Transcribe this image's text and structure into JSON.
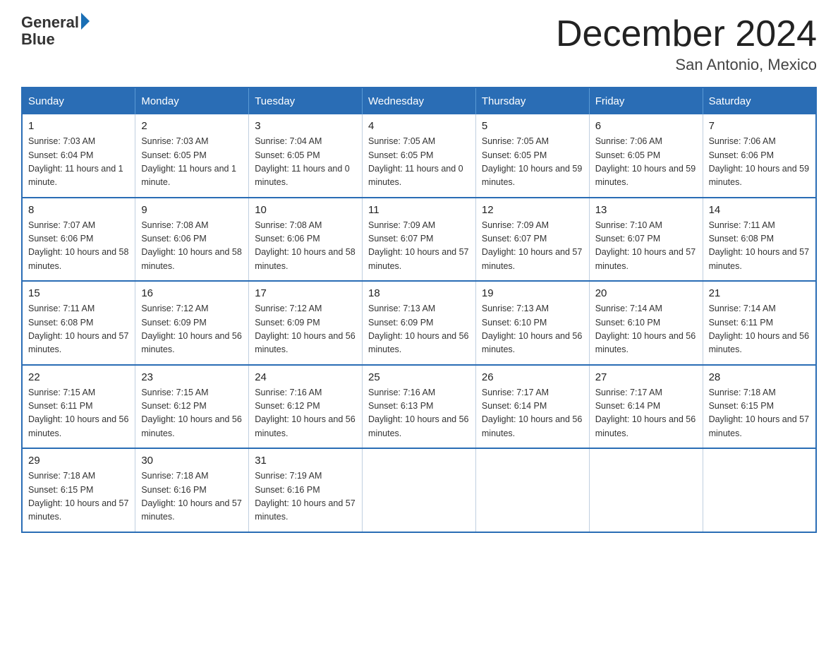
{
  "header": {
    "logo_line1": "General",
    "logo_line2": "Blue",
    "title": "December 2024",
    "subtitle": "San Antonio, Mexico"
  },
  "days_of_week": [
    "Sunday",
    "Monday",
    "Tuesday",
    "Wednesday",
    "Thursday",
    "Friday",
    "Saturday"
  ],
  "weeks": [
    [
      {
        "day": "1",
        "sunrise": "7:03 AM",
        "sunset": "6:04 PM",
        "daylight": "11 hours and 1 minute."
      },
      {
        "day": "2",
        "sunrise": "7:03 AM",
        "sunset": "6:05 PM",
        "daylight": "11 hours and 1 minute."
      },
      {
        "day": "3",
        "sunrise": "7:04 AM",
        "sunset": "6:05 PM",
        "daylight": "11 hours and 0 minutes."
      },
      {
        "day": "4",
        "sunrise": "7:05 AM",
        "sunset": "6:05 PM",
        "daylight": "11 hours and 0 minutes."
      },
      {
        "day": "5",
        "sunrise": "7:05 AM",
        "sunset": "6:05 PM",
        "daylight": "10 hours and 59 minutes."
      },
      {
        "day": "6",
        "sunrise": "7:06 AM",
        "sunset": "6:05 PM",
        "daylight": "10 hours and 59 minutes."
      },
      {
        "day": "7",
        "sunrise": "7:06 AM",
        "sunset": "6:06 PM",
        "daylight": "10 hours and 59 minutes."
      }
    ],
    [
      {
        "day": "8",
        "sunrise": "7:07 AM",
        "sunset": "6:06 PM",
        "daylight": "10 hours and 58 minutes."
      },
      {
        "day": "9",
        "sunrise": "7:08 AM",
        "sunset": "6:06 PM",
        "daylight": "10 hours and 58 minutes."
      },
      {
        "day": "10",
        "sunrise": "7:08 AM",
        "sunset": "6:06 PM",
        "daylight": "10 hours and 58 minutes."
      },
      {
        "day": "11",
        "sunrise": "7:09 AM",
        "sunset": "6:07 PM",
        "daylight": "10 hours and 57 minutes."
      },
      {
        "day": "12",
        "sunrise": "7:09 AM",
        "sunset": "6:07 PM",
        "daylight": "10 hours and 57 minutes."
      },
      {
        "day": "13",
        "sunrise": "7:10 AM",
        "sunset": "6:07 PM",
        "daylight": "10 hours and 57 minutes."
      },
      {
        "day": "14",
        "sunrise": "7:11 AM",
        "sunset": "6:08 PM",
        "daylight": "10 hours and 57 minutes."
      }
    ],
    [
      {
        "day": "15",
        "sunrise": "7:11 AM",
        "sunset": "6:08 PM",
        "daylight": "10 hours and 57 minutes."
      },
      {
        "day": "16",
        "sunrise": "7:12 AM",
        "sunset": "6:09 PM",
        "daylight": "10 hours and 56 minutes."
      },
      {
        "day": "17",
        "sunrise": "7:12 AM",
        "sunset": "6:09 PM",
        "daylight": "10 hours and 56 minutes."
      },
      {
        "day": "18",
        "sunrise": "7:13 AM",
        "sunset": "6:09 PM",
        "daylight": "10 hours and 56 minutes."
      },
      {
        "day": "19",
        "sunrise": "7:13 AM",
        "sunset": "6:10 PM",
        "daylight": "10 hours and 56 minutes."
      },
      {
        "day": "20",
        "sunrise": "7:14 AM",
        "sunset": "6:10 PM",
        "daylight": "10 hours and 56 minutes."
      },
      {
        "day": "21",
        "sunrise": "7:14 AM",
        "sunset": "6:11 PM",
        "daylight": "10 hours and 56 minutes."
      }
    ],
    [
      {
        "day": "22",
        "sunrise": "7:15 AM",
        "sunset": "6:11 PM",
        "daylight": "10 hours and 56 minutes."
      },
      {
        "day": "23",
        "sunrise": "7:15 AM",
        "sunset": "6:12 PM",
        "daylight": "10 hours and 56 minutes."
      },
      {
        "day": "24",
        "sunrise": "7:16 AM",
        "sunset": "6:12 PM",
        "daylight": "10 hours and 56 minutes."
      },
      {
        "day": "25",
        "sunrise": "7:16 AM",
        "sunset": "6:13 PM",
        "daylight": "10 hours and 56 minutes."
      },
      {
        "day": "26",
        "sunrise": "7:17 AM",
        "sunset": "6:14 PM",
        "daylight": "10 hours and 56 minutes."
      },
      {
        "day": "27",
        "sunrise": "7:17 AM",
        "sunset": "6:14 PM",
        "daylight": "10 hours and 56 minutes."
      },
      {
        "day": "28",
        "sunrise": "7:18 AM",
        "sunset": "6:15 PM",
        "daylight": "10 hours and 57 minutes."
      }
    ],
    [
      {
        "day": "29",
        "sunrise": "7:18 AM",
        "sunset": "6:15 PM",
        "daylight": "10 hours and 57 minutes."
      },
      {
        "day": "30",
        "sunrise": "7:18 AM",
        "sunset": "6:16 PM",
        "daylight": "10 hours and 57 minutes."
      },
      {
        "day": "31",
        "sunrise": "7:19 AM",
        "sunset": "6:16 PM",
        "daylight": "10 hours and 57 minutes."
      },
      null,
      null,
      null,
      null
    ]
  ],
  "labels": {
    "sunrise": "Sunrise:",
    "sunset": "Sunset:",
    "daylight": "Daylight:"
  }
}
